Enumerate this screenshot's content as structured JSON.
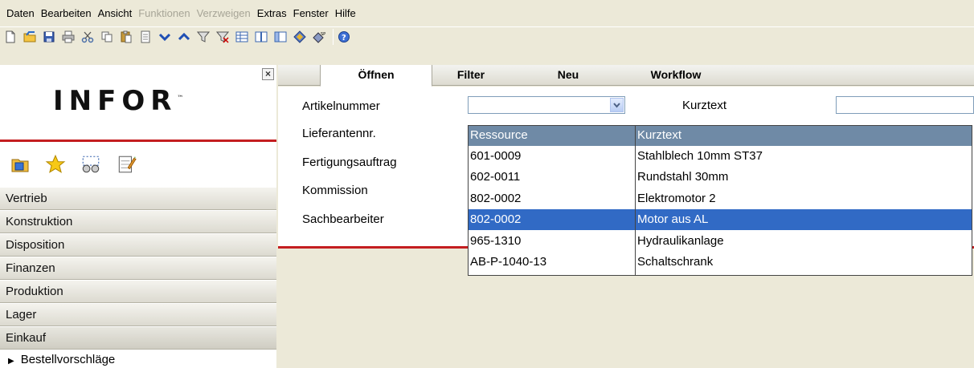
{
  "menu": [
    "Daten",
    "Bearbeiten",
    "Ansicht",
    "Funktionen",
    "Verzweigen",
    "Extras",
    "Fenster",
    "Hilfe"
  ],
  "menu_disabled": [
    "Funktionen",
    "Verzweigen"
  ],
  "toolbar_icons": [
    "new-document-icon",
    "open-folder-icon",
    "save-icon",
    "print-icon",
    "cut-icon",
    "copy-icon",
    "paste-icon",
    "page-icon",
    "arrow-down-icon",
    "arrow-up-icon",
    "filter-icon",
    "clear-filter-icon",
    "table-icon",
    "columns-icon",
    "panel-icon",
    "diamond-icon",
    "special-icon",
    "help-icon"
  ],
  "left_panel": {
    "logo_text": "INFOR",
    "logo_tm": "™",
    "close_label": "×",
    "nav_items": [
      "Vertrieb",
      "Konstruktion",
      "Disposition",
      "Finanzen",
      "Produktion",
      "Lager",
      "Einkauf"
    ],
    "active_item": "Einkauf",
    "sub_items": [
      "Bestellvorschläge"
    ]
  },
  "tabs": [
    "Öffnen",
    "Filter",
    "Neu",
    "Workflow"
  ],
  "active_tab": "Öffnen",
  "form": {
    "labels": [
      "Artikelnummer",
      "Lieferantennr.",
      "Fertigungsauftrag",
      "Kommission",
      "Sachbearbeiter"
    ],
    "artikelnummer_value": "",
    "kurztext_label": "Kurztext",
    "kurztext_value": ""
  },
  "dropdown": {
    "columns": [
      "Ressource",
      "Kurztext"
    ],
    "rows": [
      {
        "ressource": "601-0009",
        "kurztext": "Stahlblech 10mm ST37"
      },
      {
        "ressource": "602-0011",
        "kurztext": "Rundstahl 30mm"
      },
      {
        "ressource": "802-0002",
        "kurztext": "Elektromotor 2"
      },
      {
        "ressource": "802-0002",
        "kurztext": "Motor aus AL"
      },
      {
        "ressource": "965-1310",
        "kurztext": "Hydraulikanlage"
      },
      {
        "ressource": "AB-P-1040-13",
        "kurztext": "Schaltschrank"
      }
    ],
    "selected_index": 3
  },
  "colors": {
    "accent_red": "#c41e20",
    "selection_blue": "#316ac5",
    "header_blue": "#6f8aa6"
  }
}
